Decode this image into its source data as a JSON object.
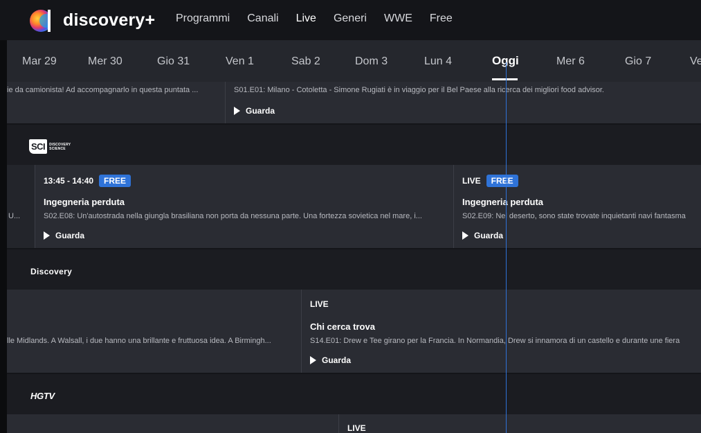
{
  "brand": {
    "name": "discovery+"
  },
  "nav": {
    "items": [
      {
        "label": "Programmi",
        "active": false
      },
      {
        "label": "Canali",
        "active": false
      },
      {
        "label": "Live",
        "active": true
      },
      {
        "label": "Generi",
        "active": false
      },
      {
        "label": "WWE",
        "active": false
      },
      {
        "label": "Free",
        "active": false
      }
    ]
  },
  "dates": [
    "Mar 29",
    "Mer 30",
    "Gio 31",
    "Ven 1",
    "Sab 2",
    "Dom 3",
    "Lun 4",
    "Oggi",
    "Mer 6",
    "Gio 7",
    "Ve"
  ],
  "rows": {
    "r1": {
      "c1": {
        "desc": "ie da camionista! Ad accompagnarlo in questa puntata ..."
      },
      "c2": {
        "desc": "S01.E01: Milano - Cotoletta - Simone Rugiati è in viaggio per il Bel Paese alla ricerca dei migliori food advisor.",
        "watch": "Guarda"
      }
    },
    "sci": {
      "channel": {
        "line1": "SCI",
        "line2a": "DISCOVERY",
        "line2b": "SCIENCE"
      },
      "c0": {
        "desc": "U..."
      },
      "c1": {
        "time": "13:45 - 14:40",
        "badge": "FREE",
        "title": "Ingegneria perduta",
        "desc": "S02.E08: Un'autostrada nella giungla brasiliana non porta da nessuna parte. Una fortezza sovietica nel mare, i...",
        "watch": "Guarda"
      },
      "c2": {
        "time": "LIVE",
        "badge": "FREE",
        "title": "Ingegneria perduta",
        "desc": "S02.E09: Nel deserto, sono state trovate inquietanti navi fantasma",
        "watch": "Guarda"
      }
    },
    "disc": {
      "channel": {
        "name": "Discovery"
      },
      "c1": {
        "desc": "lle Midlands. A Walsall, i due hanno una brillante e fruttuosa idea. A Birmingh..."
      },
      "c2": {
        "time": "LIVE",
        "title": "Chi cerca trova",
        "desc": "S14.E01: Drew e Tee girano per la Francia. In Normandia, Drew si innamora di un castello e durante une fiera",
        "watch": "Guarda"
      }
    },
    "hgtv": {
      "channel": {
        "name": "HGTV"
      },
      "c2": {
        "time": "LIVE"
      }
    }
  },
  "colors": {
    "accent": "#2f73d8",
    "background": "#141519",
    "cell": "#2a2c33"
  }
}
